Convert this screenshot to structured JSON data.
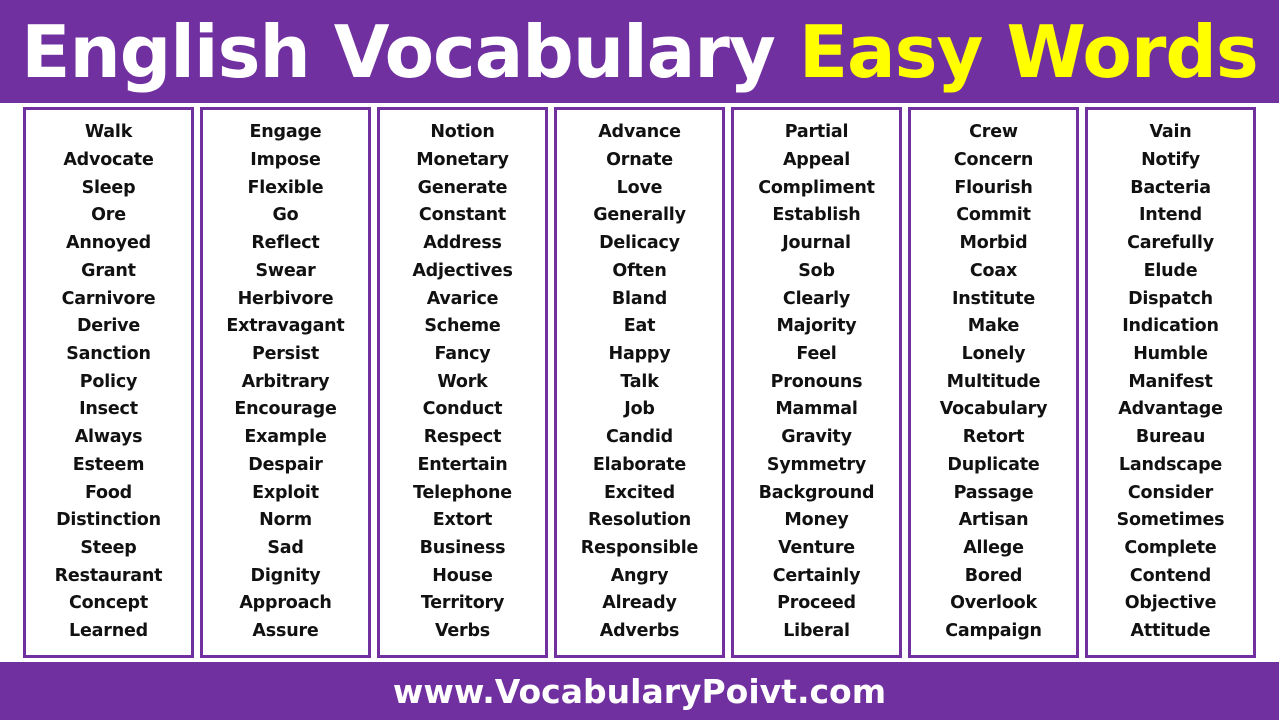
{
  "colors": {
    "brand_purple": "#7030A0",
    "accent_yellow": "#FFFF00",
    "text_white": "#FFFFFF",
    "word_text": "#111111",
    "page_background": "#FFFFFF"
  },
  "header": {
    "title_part_1": "English Vocabulary ",
    "title_part_2": "Easy Words",
    "full_title": "English Vocabulary Easy Words"
  },
  "footer": {
    "url": "www.VocabularyPoivt.com"
  },
  "columns": [
    {
      "index": 1,
      "words": [
        "Walk",
        "Advocate",
        "Sleep",
        "Ore",
        "Annoyed",
        "Grant",
        "Carnivore",
        "Derive",
        "Sanction",
        "Policy",
        "Insect",
        "Always",
        "Esteem",
        "Food",
        "Distinction",
        "Steep",
        "Restaurant",
        "Concept",
        "Learned"
      ]
    },
    {
      "index": 2,
      "words": [
        "Engage",
        "Impose",
        "Flexible",
        "Go",
        "Reflect",
        "Swear",
        "Herbivore",
        "Extravagant",
        "Persist",
        "Arbitrary",
        "Encourage",
        "Example",
        "Despair",
        "Exploit",
        "Norm",
        "Sad",
        "Dignity",
        "Approach",
        "Assure"
      ]
    },
    {
      "index": 3,
      "words": [
        "Notion",
        "Monetary",
        "Generate",
        "Constant",
        "Address",
        "Adjectives",
        "Avarice",
        "Scheme",
        "Fancy",
        "Work",
        "Conduct",
        "Respect",
        "Entertain",
        "Telephone",
        "Extort",
        "Business",
        "House",
        "Territory",
        "Verbs"
      ]
    },
    {
      "index": 4,
      "words": [
        "Advance",
        "Ornate",
        "Love",
        "Generally",
        "Delicacy",
        "Often",
        "Bland",
        "Eat",
        "Happy",
        "Talk",
        "Job",
        "Candid",
        "Elaborate",
        "Excited",
        "Resolution",
        "Responsible",
        "Angry",
        "Already",
        "Adverbs"
      ]
    },
    {
      "index": 5,
      "words": [
        "Partial",
        "Appeal",
        "Compliment",
        "Establish",
        "Journal",
        "Sob",
        "Clearly",
        "Majority",
        "Feel",
        "Pronouns",
        "Mammal",
        "Gravity",
        "Symmetry",
        "Background",
        "Money",
        "Venture",
        "Certainly",
        "Proceed",
        "Liberal"
      ]
    },
    {
      "index": 6,
      "words": [
        "Crew",
        "Concern",
        "Flourish",
        "Commit",
        "Morbid",
        "Coax",
        "Institute",
        "Make",
        "Lonely",
        "Multitude",
        "Vocabulary",
        "Retort",
        "Duplicate",
        "Passage",
        "Artisan",
        "Allege",
        "Bored",
        "Overlook",
        "Campaign"
      ]
    },
    {
      "index": 7,
      "words": [
        "Vain",
        "Notify",
        "Bacteria",
        "Intend",
        "Carefully",
        "Elude",
        "Dispatch",
        "Indication",
        "Humble",
        "Manifest",
        "Advantage",
        "Bureau",
        "Landscape",
        "Consider",
        "Sometimes",
        "Complete",
        "Contend",
        "Objective",
        "Attitude"
      ]
    }
  ]
}
